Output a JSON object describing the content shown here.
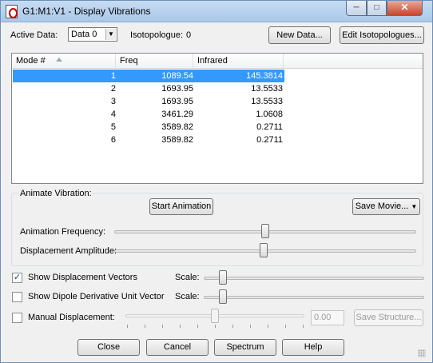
{
  "window": {
    "title": "G1:M1:V1 - Display Vibrations"
  },
  "top": {
    "active_data_label": "Active Data:",
    "active_data_value": "Data 0",
    "isotopologue_label": "Isotopologue:",
    "isotopologue_value": "0",
    "new_data_button": "New Data...",
    "edit_isotopologues_button": "Edit Isotopologues..."
  },
  "table": {
    "columns": [
      "Mode #",
      "Freq",
      "Infrared"
    ],
    "rows": [
      {
        "mode": "1",
        "freq": "1089.54",
        "ir": "145.3814",
        "selected": true
      },
      {
        "mode": "2",
        "freq": "1693.95",
        "ir": "13.5533"
      },
      {
        "mode": "3",
        "freq": "1693.95",
        "ir": "13.5533"
      },
      {
        "mode": "4",
        "freq": "3461.29",
        "ir": "1.0608"
      },
      {
        "mode": "5",
        "freq": "3589.82",
        "ir": "0.2711"
      },
      {
        "mode": "6",
        "freq": "3589.82",
        "ir": "0.2711"
      }
    ]
  },
  "animate": {
    "group_label": "Animate Vibration:",
    "start_button": "Start Animation",
    "save_movie_button": "Save Movie...",
    "frequency_label": "Animation Frequency:",
    "frequency_level": 0.62,
    "amplitude_label": "Displacement Amplitude:",
    "amplitude_level": 0.62
  },
  "options": {
    "show_displacement_vectors": {
      "label": "Show Displacement Vectors",
      "checked": true,
      "scale_label": "Scale:",
      "scale_level": 0.08
    },
    "show_dipole": {
      "label": "Show Dipole Derivative Unit Vector",
      "checked": false,
      "scale_label": "Scale:",
      "scale_level": 0.08
    },
    "manual_displacement": {
      "label": "Manual Displacement:",
      "checked": false,
      "value": "0.00",
      "level": 0.5,
      "save_structure_button": "Save Structure..."
    }
  },
  "bottom": {
    "close_button": "Close",
    "cancel_button": "Cancel",
    "spectrum_button": "Spectrum",
    "help_button": "Help"
  }
}
